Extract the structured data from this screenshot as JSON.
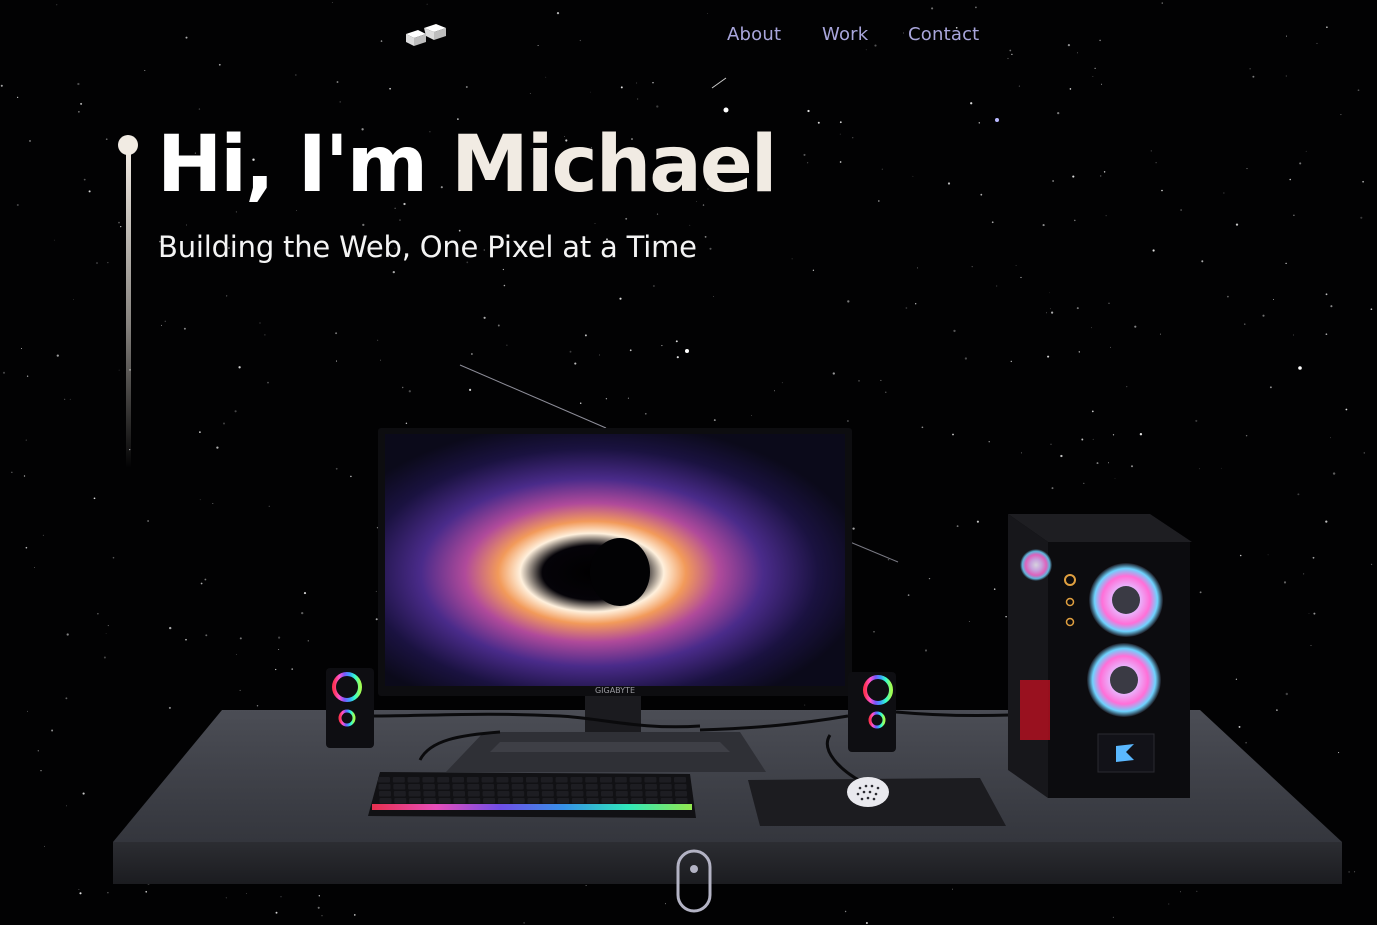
{
  "nav": {
    "logo_icon": "blocks-logo-icon",
    "links": [
      {
        "label": "About"
      },
      {
        "label": "Work"
      },
      {
        "label": "Contact"
      }
    ]
  },
  "hero": {
    "greeting": "Hi, I'm",
    "name": "Michael",
    "subtitle": "Building the Web, One Pixel at a Time"
  },
  "scene": {
    "monitor_brand": "GIGABYTE"
  },
  "scroll_icon": "mouse-scroll-icon",
  "colors": {
    "background": "#020203",
    "accent": "#a9a6dc",
    "name_highlight": "#f1ebe3"
  }
}
